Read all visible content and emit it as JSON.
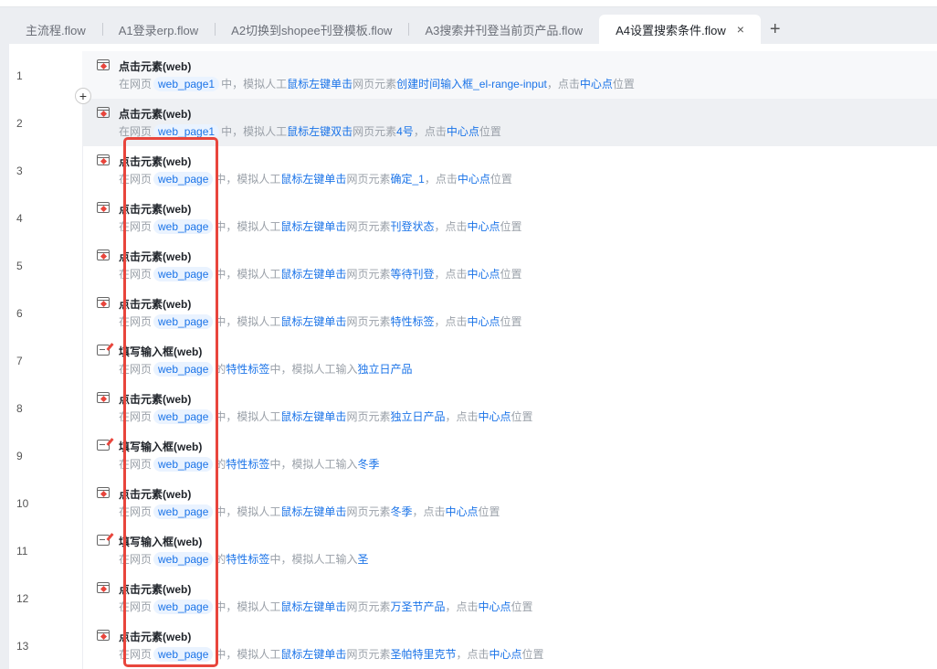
{
  "tabs": [
    {
      "label": "主流程.flow"
    },
    {
      "label": "A1登录erp.flow"
    },
    {
      "label": "A2切换到shopee刊登模板.flow"
    },
    {
      "label": "A3搜索并刊登当前页产品.flow"
    },
    {
      "label": "A4设置搜索条件.flow",
      "active": true
    }
  ],
  "close_glyph": "×",
  "add_tab": "+",
  "insert_glyph": "+",
  "rows": [
    {
      "num": "1",
      "icon": "click",
      "title": "点击元素(web)",
      "parts": [
        [
          "在网页",
          ""
        ],
        [
          "web_page1",
          "pill"
        ],
        [
          "中，模拟人工",
          ""
        ],
        [
          "鼠标左键单击",
          "hl"
        ],
        [
          "网页元素",
          ""
        ],
        [
          "创建时间输入框_el-range-input",
          "hl"
        ],
        [
          "，点击",
          ""
        ],
        [
          "中心点",
          "hl"
        ],
        [
          "位置",
          ""
        ]
      ]
    },
    {
      "num": "2",
      "icon": "click",
      "title": "点击元素(web)",
      "parts": [
        [
          "在网页",
          ""
        ],
        [
          "web_page1",
          "pill"
        ],
        [
          "中，模拟人工",
          ""
        ],
        [
          "鼠标左键双击",
          "hl"
        ],
        [
          "网页元素",
          ""
        ],
        [
          "4号",
          "hl"
        ],
        [
          "，点击",
          ""
        ],
        [
          "中心点",
          "hl"
        ],
        [
          "位置",
          ""
        ]
      ]
    },
    {
      "num": "3",
      "icon": "click",
      "title": "点击元素(web)",
      "parts": [
        [
          "在网页",
          ""
        ],
        [
          "web_page",
          "pill"
        ],
        [
          "中，模拟人工",
          ""
        ],
        [
          "鼠标左键单击",
          "hl"
        ],
        [
          "网页元素",
          ""
        ],
        [
          "确定_1",
          "hl"
        ],
        [
          "，点击",
          ""
        ],
        [
          "中心点",
          "hl"
        ],
        [
          "位置",
          ""
        ]
      ]
    },
    {
      "num": "4",
      "icon": "click",
      "title": "点击元素(web)",
      "parts": [
        [
          "在网页",
          ""
        ],
        [
          "web_page",
          "pill"
        ],
        [
          "中，模拟人工",
          ""
        ],
        [
          "鼠标左键单击",
          "hl"
        ],
        [
          "网页元素",
          ""
        ],
        [
          "刊登状态",
          "hl"
        ],
        [
          "，点击",
          ""
        ],
        [
          "中心点",
          "hl"
        ],
        [
          "位置",
          ""
        ]
      ]
    },
    {
      "num": "5",
      "icon": "click",
      "title": "点击元素(web)",
      "parts": [
        [
          "在网页",
          ""
        ],
        [
          "web_page",
          "pill"
        ],
        [
          "中，模拟人工",
          ""
        ],
        [
          "鼠标左键单击",
          "hl"
        ],
        [
          "网页元素",
          ""
        ],
        [
          "等待刊登",
          "hl"
        ],
        [
          "，点击",
          ""
        ],
        [
          "中心点",
          "hl"
        ],
        [
          "位置",
          ""
        ]
      ]
    },
    {
      "num": "6",
      "icon": "click",
      "title": "点击元素(web)",
      "parts": [
        [
          "在网页",
          ""
        ],
        [
          "web_page",
          "pill"
        ],
        [
          "中，模拟人工",
          ""
        ],
        [
          "鼠标左键单击",
          "hl"
        ],
        [
          "网页元素",
          ""
        ],
        [
          "特性标签",
          "hl"
        ],
        [
          "，点击",
          ""
        ],
        [
          "中心点",
          "hl"
        ],
        [
          "位置",
          ""
        ]
      ]
    },
    {
      "num": "7",
      "icon": "input",
      "title": "填写输入框(web)",
      "parts": [
        [
          "在网页",
          ""
        ],
        [
          "web_page",
          "pill"
        ],
        [
          "的",
          ""
        ],
        [
          "特性标签",
          "hl"
        ],
        [
          "中，模拟人工输入",
          ""
        ],
        [
          "独立日产品",
          "hl"
        ]
      ]
    },
    {
      "num": "8",
      "icon": "click",
      "title": "点击元素(web)",
      "parts": [
        [
          "在网页",
          ""
        ],
        [
          "web_page",
          "pill"
        ],
        [
          "中，模拟人工",
          ""
        ],
        [
          "鼠标左键单击",
          "hl"
        ],
        [
          "网页元素",
          ""
        ],
        [
          "独立日产品",
          "hl"
        ],
        [
          "，点击",
          ""
        ],
        [
          "中心点",
          "hl"
        ],
        [
          "位置",
          ""
        ]
      ]
    },
    {
      "num": "9",
      "icon": "input",
      "title": "填写输入框(web)",
      "parts": [
        [
          "在网页",
          ""
        ],
        [
          "web_page",
          "pill"
        ],
        [
          "的",
          ""
        ],
        [
          "特性标签",
          "hl"
        ],
        [
          "中，模拟人工输入",
          ""
        ],
        [
          "冬季",
          "hl"
        ]
      ]
    },
    {
      "num": "10",
      "icon": "click",
      "title": "点击元素(web)",
      "parts": [
        [
          "在网页",
          ""
        ],
        [
          "web_page",
          "pill"
        ],
        [
          "中，模拟人工",
          ""
        ],
        [
          "鼠标左键单击",
          "hl"
        ],
        [
          "网页元素",
          ""
        ],
        [
          "冬季",
          "hl"
        ],
        [
          "，点击",
          ""
        ],
        [
          "中心点",
          "hl"
        ],
        [
          "位置",
          ""
        ]
      ]
    },
    {
      "num": "11",
      "icon": "input",
      "title": "填写输入框(web)",
      "parts": [
        [
          "在网页",
          ""
        ],
        [
          "web_page",
          "pill"
        ],
        [
          "的",
          ""
        ],
        [
          "特性标签",
          "hl"
        ],
        [
          "中，模拟人工输入",
          ""
        ],
        [
          "圣",
          "hl"
        ]
      ]
    },
    {
      "num": "12",
      "icon": "click",
      "title": "点击元素(web)",
      "parts": [
        [
          "在网页",
          ""
        ],
        [
          "web_page",
          "pill"
        ],
        [
          "中，模拟人工",
          ""
        ],
        [
          "鼠标左键单击",
          "hl"
        ],
        [
          "网页元素",
          ""
        ],
        [
          "万圣节产品",
          "hl"
        ],
        [
          "，点击",
          ""
        ],
        [
          "中心点",
          "hl"
        ],
        [
          "位置",
          ""
        ]
      ]
    },
    {
      "num": "13",
      "icon": "click",
      "title": "点击元素(web)",
      "parts": [
        [
          "在网页",
          ""
        ],
        [
          "web_page",
          "pill"
        ],
        [
          "中，模拟人工",
          ""
        ],
        [
          "鼠标左键单击",
          "hl"
        ],
        [
          "网页元素",
          ""
        ],
        [
          "圣帕特里克节",
          "hl"
        ],
        [
          "，点击",
          ""
        ],
        [
          "中心点",
          "hl"
        ],
        [
          "位置",
          ""
        ]
      ]
    }
  ]
}
